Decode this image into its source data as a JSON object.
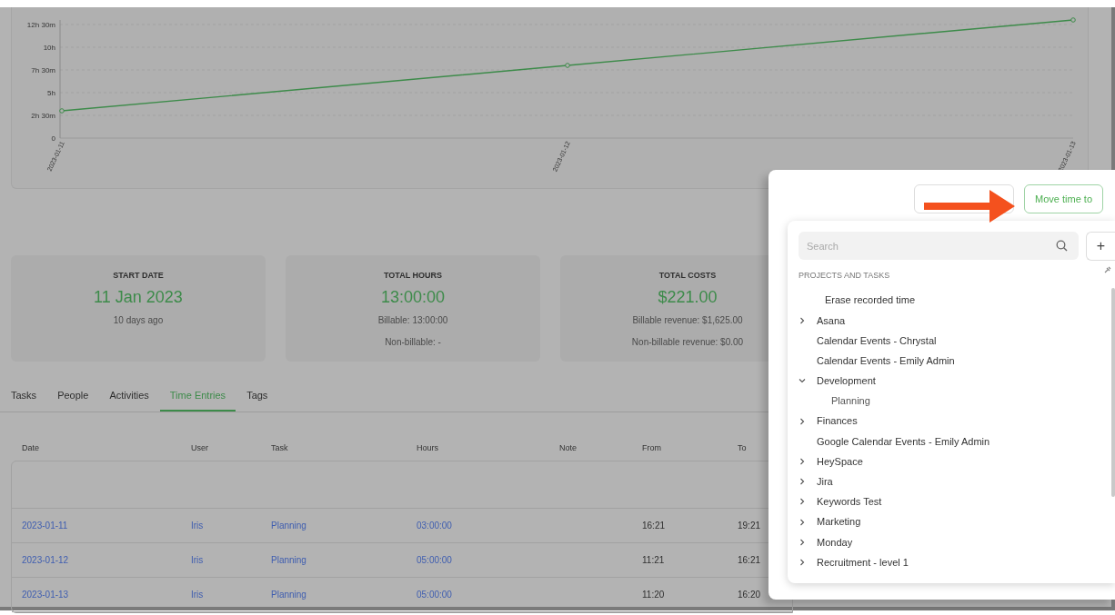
{
  "chart": {
    "chart_data": {
      "type": "line",
      "categories": [
        "2023-01-11",
        "2023-01-12",
        "2023-01-13"
      ],
      "series": [
        {
          "color": "#3d8b4a",
          "values": [
            3,
            8,
            13
          ],
          "marker": true
        }
      ],
      "grid": true,
      "ylim": [
        0,
        13
      ],
      "yticks": [
        {
          "value": 0,
          "label": "0"
        },
        {
          "value": 2.5,
          "label": "2h 30m"
        },
        {
          "value": 5,
          "label": "5h"
        },
        {
          "value": 7.5,
          "label": "7h 30m"
        },
        {
          "value": 10,
          "label": "10h"
        },
        {
          "value": 12.5,
          "label": "12h 30m"
        }
      ]
    }
  },
  "stats": [
    {
      "label": "START DATE",
      "value": "11 Jan 2023",
      "lines": [
        "10 days ago"
      ]
    },
    {
      "label": "TOTAL HOURS",
      "value": "13:00:00",
      "lines": [
        "Billable: 13:00:00",
        "Non-billable: -"
      ]
    },
    {
      "label": "TOTAL COSTS",
      "value": "$221.00",
      "lines": [
        "Billable revenue: $1,625.00",
        "Non-billable revenue: $0.00"
      ]
    }
  ],
  "tabs": [
    {
      "label": "Tasks",
      "selected": false
    },
    {
      "label": "People",
      "selected": false
    },
    {
      "label": "Activities",
      "selected": false
    },
    {
      "label": "Time Entries",
      "selected": true
    },
    {
      "label": "Tags",
      "selected": false
    }
  ],
  "table": {
    "columns": [
      "Date",
      "User",
      "Task",
      "Hours",
      "Note",
      "From",
      "To"
    ],
    "rows": [
      {
        "date": "2023-01-11",
        "user": "Iris",
        "task": "Planning",
        "hours": "03:00:00",
        "from": "16:21",
        "to": "19:21"
      },
      {
        "date": "2023-01-12",
        "user": "Iris",
        "task": "Planning",
        "hours": "05:00:00",
        "from": "11:21",
        "to": "16:21"
      },
      {
        "date": "2023-01-13",
        "user": "Iris",
        "task": "Planning",
        "hours": "05:00:00",
        "from": "11:20",
        "to": "16:20"
      }
    ]
  },
  "popup": {
    "primary_button": "Move time to",
    "search": {
      "placeholder": "Search"
    },
    "add_button": "+",
    "section_title": "PROJECTS AND TASKS",
    "items": [
      {
        "label": "Erase recorded time",
        "kind": "action"
      },
      {
        "label": "Asana",
        "kind": "group",
        "expanded": false
      },
      {
        "label": "Calendar Events - Chrystal",
        "kind": "project"
      },
      {
        "label": "Calendar Events - Emily Admin",
        "kind": "project"
      },
      {
        "label": "Development",
        "kind": "group",
        "expanded": true,
        "children": [
          {
            "label": "Planning",
            "kind": "task"
          }
        ]
      },
      {
        "label": "Finances",
        "kind": "group",
        "expanded": false
      },
      {
        "label": "Google Calendar Events - Emily Admin",
        "kind": "project"
      },
      {
        "label": "HeySpace",
        "kind": "group",
        "expanded": false
      },
      {
        "label": "Jira",
        "kind": "group",
        "expanded": false
      },
      {
        "label": "Keywords Test",
        "kind": "group",
        "expanded": false
      },
      {
        "label": "Marketing",
        "kind": "group",
        "expanded": false
      },
      {
        "label": "Monday",
        "kind": "group",
        "expanded": false
      },
      {
        "label": "Recruitment - level 1",
        "kind": "group",
        "expanded": false
      }
    ]
  }
}
